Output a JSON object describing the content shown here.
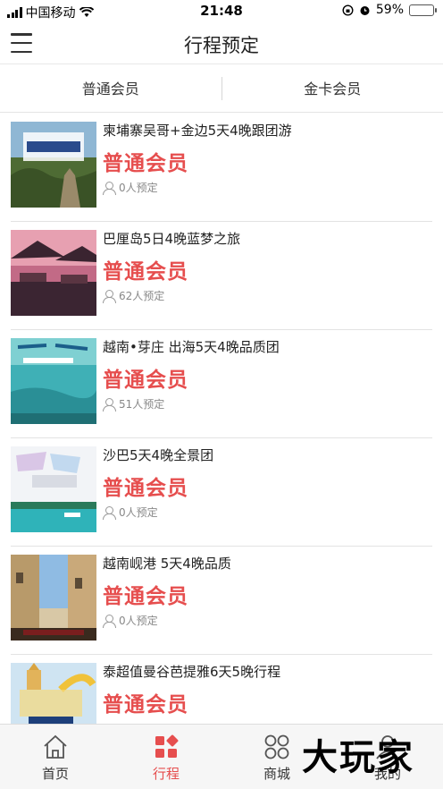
{
  "status_bar": {
    "carrier": "中国移动",
    "time": "21:48",
    "battery": "59%",
    "battery_level": 0.59
  },
  "nav": {
    "title": "行程预定"
  },
  "tabs": [
    {
      "label": "普通会员"
    },
    {
      "label": "金卡会员"
    }
  ],
  "items": [
    {
      "title": "柬埔寨吴哥+金边5天4晚跟团游",
      "tag": "普通会员",
      "bookings": "0人预定"
    },
    {
      "title": "巴厘岛5日4晚蓝梦之旅",
      "tag": "普通会员",
      "bookings": "62人预定"
    },
    {
      "title": "越南•芽庄 出海5天4晚品质团",
      "tag": "普通会员",
      "bookings": "51人预定"
    },
    {
      "title": "沙巴5天4晚全景团",
      "tag": "普通会员",
      "bookings": "0人预定"
    },
    {
      "title": "越南岘港 5天4晚品质",
      "tag": "普通会员",
      "bookings": "0人预定"
    },
    {
      "title": "泰超值曼谷芭提雅6天5晚行程",
      "tag": "普通会员",
      "bookings": ""
    }
  ],
  "tab_bar": [
    {
      "label": "首页",
      "icon": "home-icon"
    },
    {
      "label": "行程",
      "icon": "itinerary-grid-icon"
    },
    {
      "label": "商城",
      "icon": "shop-circles-icon"
    },
    {
      "label": "我的",
      "icon": "profile-icon"
    }
  ],
  "watermark": "大玩家",
  "colors": {
    "accent": "#e64e4e",
    "battery_green": "#4cd964"
  }
}
